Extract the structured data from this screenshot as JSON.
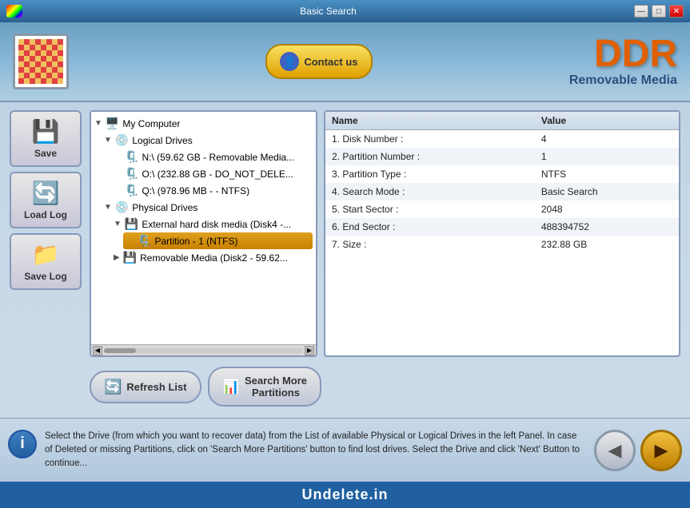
{
  "titlebar": {
    "title": "Basic Search",
    "minimize": "—",
    "maximize": "□",
    "close": "✕"
  },
  "header": {
    "contact_label": "Contact us",
    "brand_ddr": "DDR",
    "brand_sub": "Removable Media"
  },
  "sidebar": {
    "buttons": [
      {
        "id": "save",
        "label": "Save",
        "icon": "💾"
      },
      {
        "id": "load-log",
        "label": "Load Log",
        "icon": "🔄"
      },
      {
        "id": "save-log",
        "label": "Save Log",
        "icon": "📁"
      }
    ]
  },
  "tree": {
    "items": [
      {
        "level": 0,
        "label": "My Computer",
        "icon": "🖥️",
        "expanded": true
      },
      {
        "level": 1,
        "label": "Logical Drives",
        "icon": "💿",
        "expanded": true
      },
      {
        "level": 2,
        "label": "N:\\ (59.62 GB - Removable Media...",
        "icon": "🗜️"
      },
      {
        "level": 2,
        "label": "O:\\ (232.88 GB - DO_NOT_DELE...",
        "icon": "🗜️"
      },
      {
        "level": 2,
        "label": "Q:\\ (978.96 MB -  - NTFS)",
        "icon": "🗜️"
      },
      {
        "level": 1,
        "label": "Physical Drives",
        "icon": "💿",
        "expanded": true
      },
      {
        "level": 2,
        "label": "External hard disk media (Disk4 -...",
        "icon": "💾",
        "expanded": true
      },
      {
        "level": 3,
        "label": "Partition - 1 (NTFS)",
        "icon": "🗜️",
        "selected": true
      },
      {
        "level": 2,
        "label": "Removable Media (Disk2 - 59.62...",
        "icon": "💾"
      }
    ]
  },
  "info_table": {
    "columns": [
      {
        "id": "name",
        "label": "Name"
      },
      {
        "id": "value",
        "label": "Value"
      }
    ],
    "rows": [
      {
        "name": "1. Disk Number :",
        "value": "4"
      },
      {
        "name": "2. Partition Number :",
        "value": "1"
      },
      {
        "name": "3. Partition Type :",
        "value": "NTFS"
      },
      {
        "name": "4. Search Mode :",
        "value": "Basic Search"
      },
      {
        "name": "5. Start Sector :",
        "value": "2048"
      },
      {
        "name": "6. End Sector :",
        "value": "488394752"
      },
      {
        "name": "7. Size :",
        "value": "232.88 GB"
      }
    ]
  },
  "buttons": {
    "refresh": "Refresh List",
    "search": "Search More\nPartitions"
  },
  "status": {
    "text": "Select the Drive (from which you want to recover data) from the List of available Physical or Logical Drives in the left Panel. In case of Deleted or missing Partitions, click on 'Search More Partitions' button to find lost drives. Select the Drive and click 'Next' Button to continue..."
  },
  "footer": {
    "label": "Undelete.in"
  }
}
